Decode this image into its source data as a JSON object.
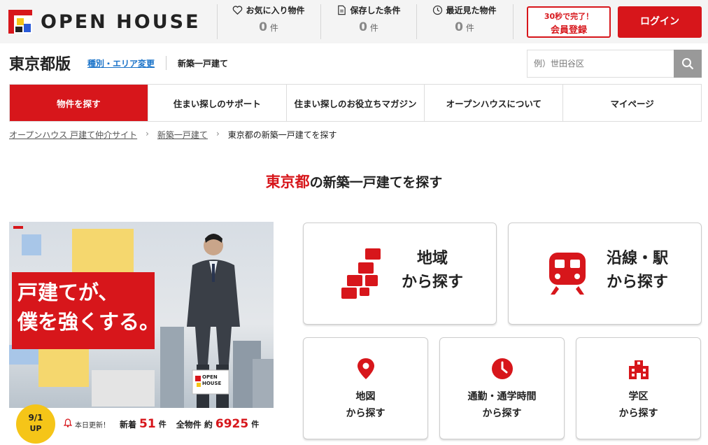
{
  "header": {
    "logo_text": "OPEN HOUSE",
    "stats": [
      {
        "label": "お気に入り物件",
        "count": "0",
        "unit": "件",
        "icon": "heart-icon"
      },
      {
        "label": "保存した条件",
        "count": "0",
        "unit": "件",
        "icon": "document-icon"
      },
      {
        "label": "最近見た物件",
        "count": "0",
        "unit": "件",
        "icon": "clock-icon"
      }
    ],
    "register_line1": "30秒で完了！",
    "register_line2": "会員登録",
    "login_label": "ログイン"
  },
  "region": {
    "title": "東京都版",
    "change_link": "種別・エリア変更",
    "type": "新築一戸建て"
  },
  "search": {
    "placeholder": "例）世田谷区"
  },
  "nav": [
    "物件を探す",
    "住まい探しのサポート",
    "住まい探しのお役立ちマガジン",
    "オープンハウスについて",
    "マイページ"
  ],
  "breadcrumb": {
    "home": "オープンハウス 戸建て仲介サイト",
    "category": "新築一戸建て",
    "current": "東京都の新築一戸建てを探す",
    "separator": "›"
  },
  "heading": {
    "highlight": "東京都",
    "rest": "の新築一戸建てを探す"
  },
  "hero": {
    "tagline_1": "戸建てが、",
    "tagline_2": "僕を強くする。",
    "sign_text_1": "OPEN",
    "sign_text_2": "HOUSE",
    "badge_date": "9/1",
    "badge_label": "UP",
    "updated_label": "本日更新！",
    "new_label": "新着",
    "new_count": "51",
    "new_unit": "件",
    "total_label": "全物件 約",
    "total_count": "6925",
    "total_unit": "件"
  },
  "cards": {
    "area": {
      "line1": "地域",
      "line2": "から探す",
      "icon": "area-blocks-icon"
    },
    "station": {
      "line1": "沿線・駅",
      "line2": "から探す",
      "icon": "train-icon"
    },
    "map": {
      "line1": "地図",
      "line2": "から探す",
      "icon": "map-pin-icon"
    },
    "commute": {
      "line1": "通勤・通学時間",
      "line2": "から探す",
      "icon": "clock-icon"
    },
    "school": {
      "line1": "学区",
      "line2": "から探す",
      "icon": "school-icon"
    }
  },
  "colors": {
    "brand_red": "#d7161b",
    "link_blue": "#1a73c9",
    "badge_yellow": "#f5c518"
  }
}
